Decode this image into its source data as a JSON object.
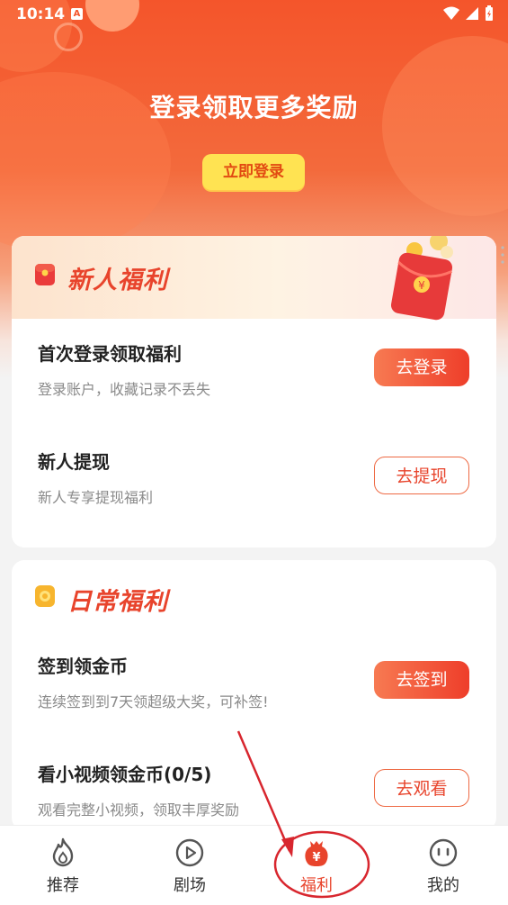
{
  "status_bar": {
    "time": "10:14",
    "notification_icon": "A"
  },
  "hero": {
    "title": "登录领取更多奖励",
    "login_button": "立即登录"
  },
  "newcomer_section": {
    "title": "新人福利",
    "items": [
      {
        "title": "首次登录领取福利",
        "subtitle": "登录账户，收藏记录不丢失",
        "button": "去登录",
        "style": "filled"
      },
      {
        "title": "新人提现",
        "subtitle": "新人专享提现福利",
        "button": "去提现",
        "style": "outline"
      }
    ]
  },
  "daily_section": {
    "title": "日常福利",
    "items": [
      {
        "title": "签到领金币",
        "subtitle": "连续签到到7天领超级大奖，可补签!",
        "button": "去签到",
        "style": "filled"
      },
      {
        "title": "看小视频领金币(0/5)",
        "subtitle": "观看完整小视频，领取丰厚奖励",
        "button": "去观看",
        "style": "outline"
      }
    ]
  },
  "bottom_nav": {
    "items": [
      {
        "label": "推荐",
        "icon": "flame-icon"
      },
      {
        "label": "剧场",
        "icon": "play-icon"
      },
      {
        "label": "福利",
        "icon": "money-bag-icon",
        "active": true
      },
      {
        "label": "我的",
        "icon": "face-icon"
      }
    ]
  },
  "colors": {
    "accent": "#e8442c",
    "hero": "#f4552b",
    "login_button": "#ffe352"
  }
}
